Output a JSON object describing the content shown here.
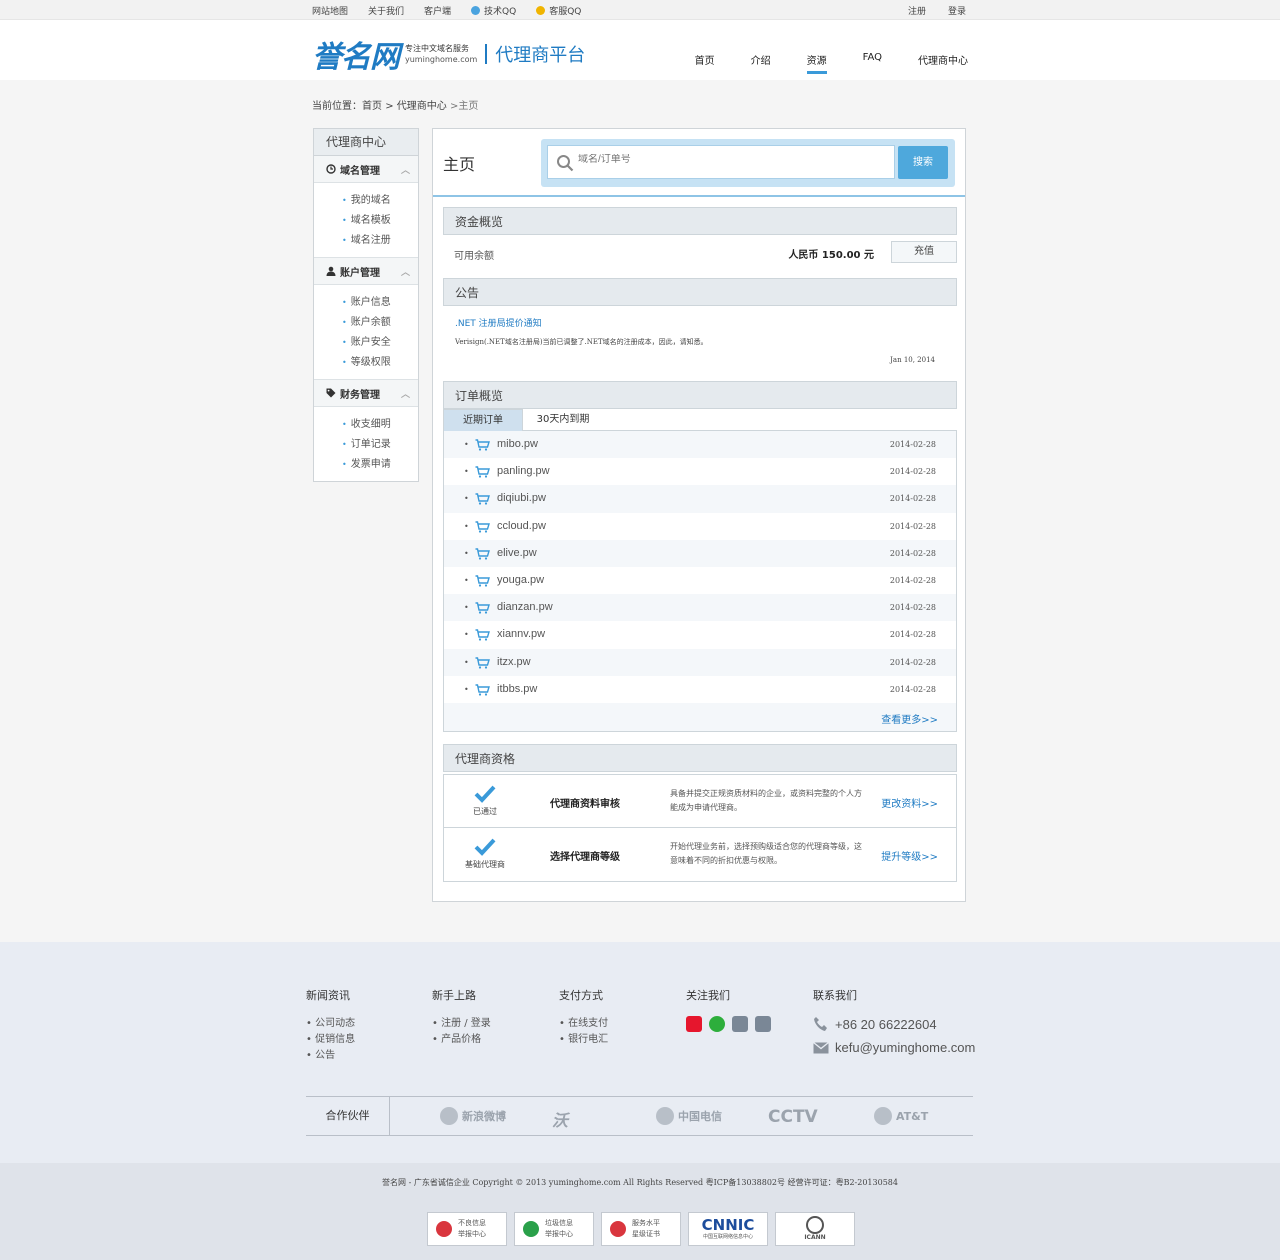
{
  "topbar": {
    "links": [
      "网站地图",
      "关于我们",
      "客户端"
    ],
    "qq_tech": "技术QQ",
    "qq_service": "客服QQ",
    "register": "注册",
    "login": "登录"
  },
  "header": {
    "brand": "誉名网",
    "slogan_cn": "专注中文域名服务",
    "slogan_en": "yuminghome.com",
    "platform": "代理商平台",
    "nav": [
      "首页",
      "介绍",
      "资源",
      "FAQ",
      "代理商中心"
    ],
    "nav_active": "资源"
  },
  "breadcrumb": {
    "prefix": "当前位置：",
    "home": "首页",
    "center": "代理商中心",
    "current": "主页"
  },
  "sidebar": {
    "title": "代理商中心",
    "groups": [
      {
        "label": "域名管理",
        "icon": "clock-icon",
        "items": [
          "我的域名",
          "域名模板",
          "域名注册"
        ]
      },
      {
        "label": "账户管理",
        "icon": "user-icon",
        "items": [
          "账户信息",
          "账户余额",
          "账户安全",
          "等级权限"
        ]
      },
      {
        "label": "财务管理",
        "icon": "tag-icon",
        "items": [
          "收支细明",
          "订单记录",
          "发票申请"
        ]
      }
    ]
  },
  "main": {
    "title": "主页",
    "search_placeholder": "域名/订单号",
    "search_button": "搜索",
    "funds": {
      "title": "资金概览",
      "label": "可用余额",
      "amount": "人民币 150.00 元",
      "recharge": "充值"
    },
    "notice": {
      "title": "公告",
      "item_title": ".NET 注册局提价通知",
      "item_desc": "Verisign(.NET域名注册局)当前已调整了.NET域名的注册成本，因此，请知悉。",
      "item_date": "Jan 10, 2014"
    },
    "orders": {
      "title": "订单概览",
      "tabs": [
        "近期订单",
        "30天内到期"
      ],
      "active_tab": 0,
      "rows": [
        {
          "domain": "mibo.pw",
          "date": "2014-02-28"
        },
        {
          "domain": "panling.pw",
          "date": "2014-02-28"
        },
        {
          "domain": "diqiubi.pw",
          "date": "2014-02-28"
        },
        {
          "domain": "ccloud.pw",
          "date": "2014-02-28"
        },
        {
          "domain": "elive.pw",
          "date": "2014-02-28"
        },
        {
          "domain": "youga.pw",
          "date": "2014-02-28"
        },
        {
          "domain": "dianzan.pw",
          "date": "2014-02-28"
        },
        {
          "domain": "xiannv.pw",
          "date": "2014-02-28"
        },
        {
          "domain": "itzx.pw",
          "date": "2014-02-28"
        },
        {
          "domain": "itbbs.pw",
          "date": "2014-02-28"
        }
      ],
      "more": "查看更多>>"
    },
    "qualification": {
      "title": "代理商资格",
      "rows": [
        {
          "status": "已通过",
          "name": "代理商资料审核",
          "desc": "具备并提交正规资质材料的企业，或资料完整的个人方能成为申请代理商。",
          "action": "更改资料>>"
        },
        {
          "status": "基础代理商",
          "name": "选择代理商等级",
          "desc": "开始代理业务前，选择预购级适合您的代理商等级，这意味着不同的折扣优惠与权限。",
          "action": "提升等级>>"
        }
      ]
    }
  },
  "footer": {
    "cols": [
      {
        "title": "新闻资讯",
        "items": [
          "公司动态",
          "促销信息",
          "公告"
        ]
      },
      {
        "title": "新手上路",
        "items": [
          "注册 / 登录",
          "产品价格"
        ]
      },
      {
        "title": "支付方式",
        "items": [
          "在线支付",
          "银行电汇"
        ]
      }
    ],
    "follow_title": "关注我们",
    "social": [
      {
        "name": "weibo-icon",
        "color": "#e6162d"
      },
      {
        "name": "wechat-icon",
        "color": "#2dae3c"
      },
      {
        "name": "twitter-icon",
        "color": "#7a8796"
      },
      {
        "name": "facebook-icon",
        "color": "#7a8796"
      }
    ],
    "contact_title": "联系我们",
    "phone": "+86 20 66222604",
    "email": "kefu@yuminghome.com",
    "partners_label": "合作伙伴",
    "partners": [
      "新浪微博",
      "沃",
      "中国电信",
      "CCTV",
      "AT&T"
    ],
    "copyright": "誉名网 - 广东省诚信企业      Copyright © 2013 yuminghome.com All Rights Reserved 粤ICP备13038802号      经营许可证：粤B2-20130584",
    "badges": [
      {
        "line1": "不良信息",
        "line2": "举报中心",
        "color": "#d9363e"
      },
      {
        "line1": "垃圾信息",
        "line2": "举报中心",
        "color": "#2aa04a"
      },
      {
        "line1": "服务水平",
        "line2": "星级证书",
        "color": "#d9363e"
      },
      {
        "line1": "CNNIC",
        "line2": "中国互联网络信息中心",
        "color": "#1d4d9c"
      },
      {
        "line1": "ICANN",
        "line2": "",
        "color": "#555555"
      }
    ]
  }
}
